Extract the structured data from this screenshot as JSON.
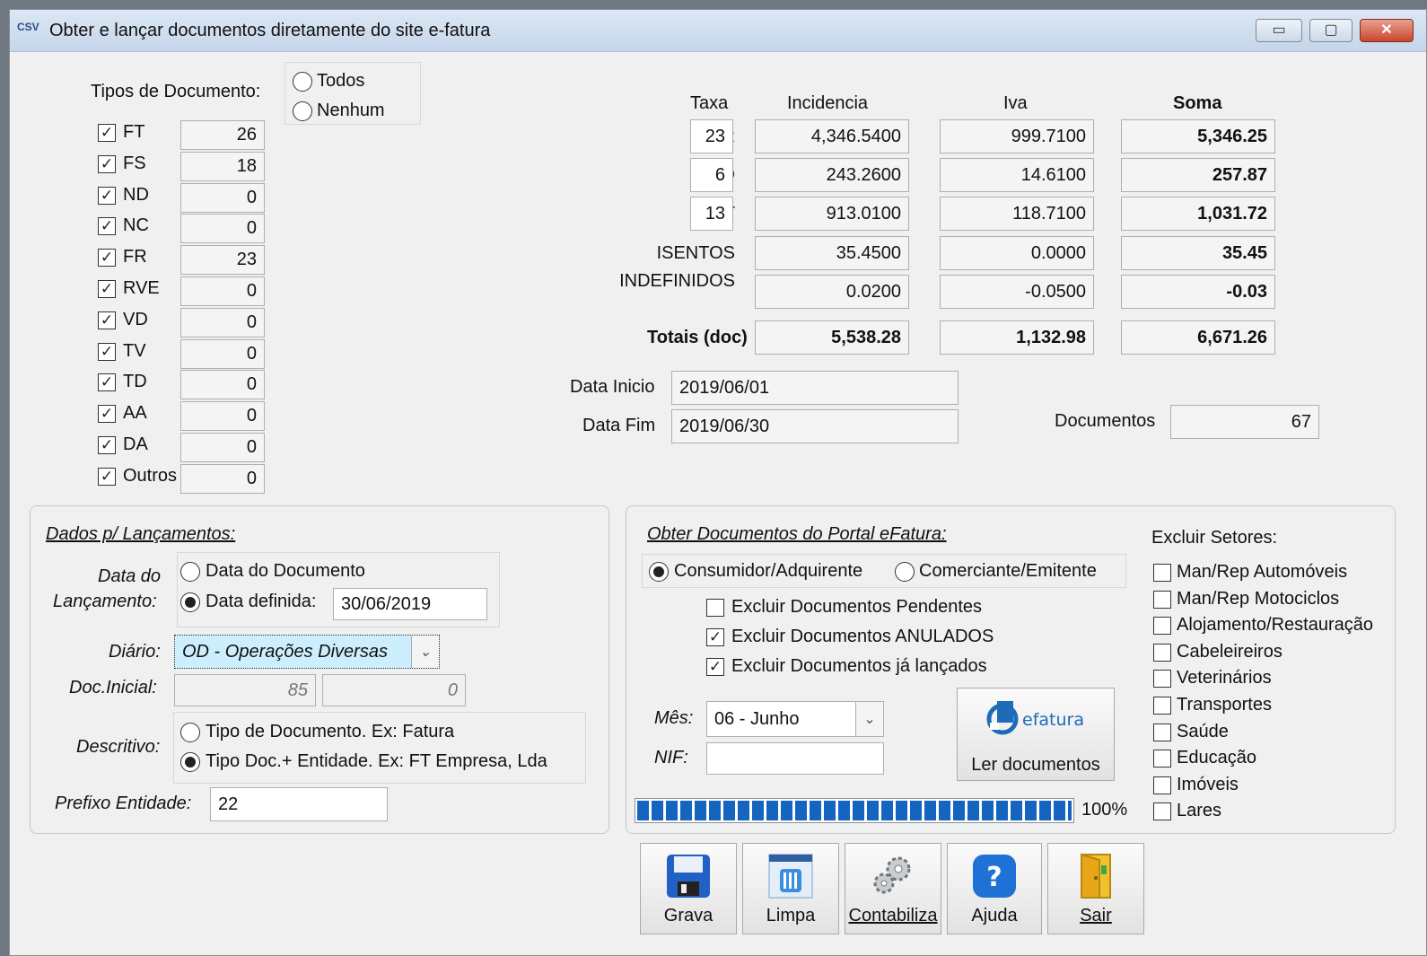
{
  "window": {
    "title": "Obter e lançar documentos diretamente do site e-fatura",
    "app_icon_text": "CSV",
    "controls": {
      "minimize": "▭",
      "maximize": "▢",
      "close": "✕"
    }
  },
  "doc_types": {
    "label": "Tipos de Documento:",
    "all_label": "Todos",
    "none_label": "Nenhum",
    "items": [
      {
        "code": "FT",
        "count": "26",
        "checked": true
      },
      {
        "code": "FS",
        "count": "18",
        "checked": true
      },
      {
        "code": "ND",
        "count": "0",
        "checked": true
      },
      {
        "code": "NC",
        "count": "0",
        "checked": true
      },
      {
        "code": "FR",
        "count": "23",
        "checked": true
      },
      {
        "code": "RVE",
        "count": "0",
        "checked": true
      },
      {
        "code": "VD",
        "count": "0",
        "checked": true
      },
      {
        "code": "TV",
        "count": "0",
        "checked": true
      },
      {
        "code": "TD",
        "count": "0",
        "checked": true
      },
      {
        "code": "AA",
        "count": "0",
        "checked": true
      },
      {
        "code": "DA",
        "count": "0",
        "checked": true
      },
      {
        "code": "Outros",
        "count": "0",
        "checked": true
      }
    ]
  },
  "summary": {
    "headers": {
      "taxa": "Taxa",
      "incidencia": "Incidencia",
      "iva": "Iva",
      "soma": "Soma"
    },
    "rows": [
      {
        "label": "NOR",
        "taxa": "23",
        "incidencia": "4,346.5400",
        "iva": "999.7100",
        "soma": "5,346.25"
      },
      {
        "label": "RED",
        "taxa": "6",
        "incidencia": "243.2600",
        "iva": "14.6100",
        "soma": "257.87"
      },
      {
        "label": "INT",
        "taxa": "13",
        "incidencia": "913.0100",
        "iva": "118.7100",
        "soma": "1,031.72"
      },
      {
        "label": "ISENTOS",
        "taxa": "",
        "incidencia": "35.4500",
        "iva": "0.0000",
        "soma": "35.45"
      },
      {
        "label": "INDEFINIDOS",
        "taxa": "",
        "incidencia": "0.0200",
        "iva": "-0.0500",
        "soma": "-0.03"
      }
    ],
    "totals": {
      "label": "Totais (doc)",
      "incidencia": "5,538.28",
      "iva": "1,132.98",
      "soma": "6,671.26"
    }
  },
  "dates": {
    "inicio_label": "Data Inicio",
    "inicio_value": "2019/06/01",
    "fim_label": "Data Fim",
    "fim_value": "2019/06/30",
    "documentos_label": "Documentos",
    "documentos_value": "67"
  },
  "lancamentos": {
    "title": "Dados p/ Lançamentos:",
    "data_label_1": "Data do",
    "data_label_2": "Lançamento:",
    "opt_documento": "Data do Documento",
    "opt_definida": "Data definida:",
    "data_definida_value": "30/06/2019",
    "diario_label": "Diário:",
    "diario_value": "OD - Operações Diversas",
    "doc_inicial_label": "Doc.Inicial:",
    "doc_inicial_value_1": "85",
    "doc_inicial_value_2": "0",
    "descritivo_label": "Descritivo:",
    "desc_opt_1": "Tipo de Documento. Ex: Fatura",
    "desc_opt_2": "Tipo Doc.+ Entidade. Ex: FT Empresa, Lda",
    "prefixo_label": "Prefixo Entidade:",
    "prefixo_value": "22"
  },
  "portal": {
    "title": "Obter Documentos do Portal eFatura:",
    "opt_consumidor": "Consumidor/Adquirente",
    "opt_comerciante": "Comerciante/Emitente",
    "excl_pendentes": "Excluir Documentos Pendentes",
    "excl_anulados": "Excluir Documentos ANULADOS",
    "excl_lancados": "Excluir Documentos já lançados",
    "mes_label": "Mês:",
    "mes_value": "06 - Junho",
    "nif_label": "NIF:",
    "nif_value": "",
    "efatura_logo": "efatura",
    "ler_label": "Ler documentos",
    "progress_text": "100%",
    "progress": 1.0
  },
  "setores": {
    "title": "Excluir Setores:",
    "items": [
      "Man/Rep Automóveis",
      "Man/Rep Motociclos",
      "Alojamento/Restauração",
      "Cabeleireiros",
      "Veterinários",
      "Transportes",
      "Saúde",
      "Educação",
      "Imóveis",
      "Lares"
    ]
  },
  "toolbar": {
    "grava": "Grava",
    "limpa": "Limpa",
    "contabiliza": "Contabiliza",
    "ajuda": "Ajuda",
    "sair": "Sair"
  },
  "colors": {
    "accent": "#1565c0",
    "diario_bg": "#cdeffd",
    "window_bg": "#f0f0f0",
    "close_red": "#c8472e"
  }
}
